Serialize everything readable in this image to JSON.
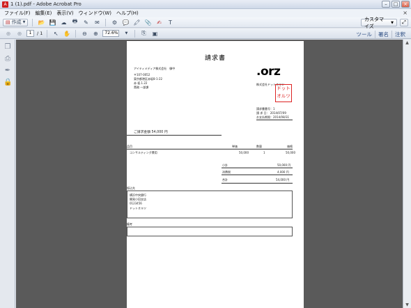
{
  "window": {
    "title": "1 (1).pdf - Adobe Acrobat Pro"
  },
  "menubar": {
    "items": [
      "ファイル(F)",
      "編集(E)",
      "表示(V)",
      "ウィンドウ(W)",
      "ヘルプ(H)"
    ]
  },
  "toolbar": {
    "create_label": "作成",
    "customize_label": "カスタマイズ"
  },
  "nav": {
    "page_current": "1",
    "page_total": "/ 1",
    "zoom": "72.6%"
  },
  "right_panel": {
    "tools": "ツール",
    "sign": "署名",
    "comment": "注釈"
  },
  "invoice": {
    "title": "請求書",
    "client_name": "アイティメディア株式会社　御中",
    "client_address": [
      "〒107-0052",
      "東京都港区赤坂8-1-22",
      "赤 坂.1.22",
      "責務 一部課"
    ],
    "logo": ".orz",
    "company_name": "株式会社ドットオルツ",
    "stamp_lines": [
      "ドット",
      "オルツ"
    ],
    "meta": [
      "請求書番号：1",
      "請 求 日： 2014/07/09",
      "お支払期限：2014/08/31"
    ],
    "total_label": "ご請求金額  54,000 円",
    "table_headers": {
      "item": "品目",
      "price": "単価",
      "qty": "数量",
      "amount": "価格"
    },
    "rows": [
      {
        "item": "コンサルティング費用",
        "price": "50,000",
        "qty": "1",
        "amount": "50,000"
      }
    ],
    "subtotal_label": "小計",
    "subtotal_value": "50,000 円",
    "tax_label": "消費税",
    "tax_value": "4,000 円",
    "grand_label": "合計",
    "grand_value": "54,000 円",
    "bank_heading": "振込先",
    "bank_lines": [
      "横浜中央銀行",
      "開発小田支店",
      "0123456",
      "ドットオルツ"
    ],
    "notes_heading": "備考"
  }
}
